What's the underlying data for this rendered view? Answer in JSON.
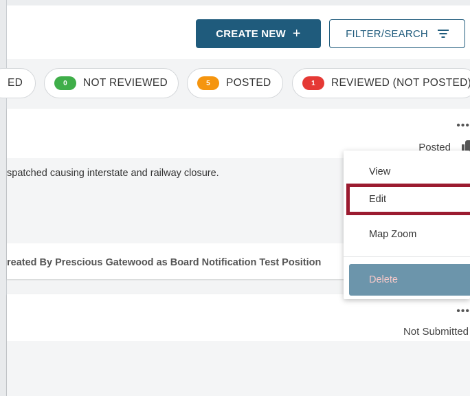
{
  "toolbar": {
    "create_label": "CREATE NEW",
    "create_icon": "+",
    "filter_label": "FILTER/SEARCH"
  },
  "chips": [
    {
      "label": "ED"
    },
    {
      "label": "NOT REVIEWED",
      "count": "0",
      "color": "#3fae49"
    },
    {
      "label": "POSTED",
      "count": "5",
      "color": "#f5950f"
    },
    {
      "label": "REVIEWED (NOT POSTED)",
      "count": "1",
      "color": "#e53935"
    }
  ],
  "cards": [
    {
      "menu_dots": "•••",
      "status": "Posted",
      "description": "spatched causing interstate and railway closure.",
      "created_by": "reated By Prescious Gatewood as Board Notification Test Position"
    },
    {
      "menu_dots": "•••",
      "status": "Not Submitted"
    }
  ],
  "context_menu": {
    "view": "View",
    "edit": "Edit",
    "map_zoom": "Map Zoom",
    "delete": "Delete"
  },
  "colors": {
    "primary": "#1f5b7c",
    "highlight_border": "#9b1b30",
    "delete_bg": "#6c95ab"
  }
}
